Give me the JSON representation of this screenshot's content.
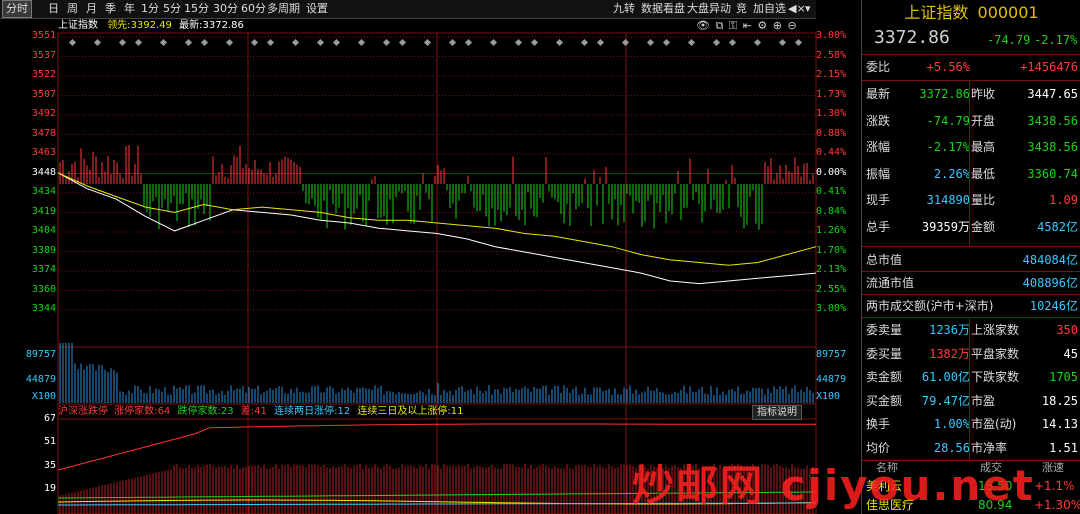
{
  "toolbar": {
    "left_items": [
      "分时",
      "日",
      "周",
      "月",
      "季",
      "年",
      "1分",
      "5分",
      "15分",
      "30分",
      "60分",
      "多周期",
      "设置"
    ],
    "right_items": [
      "九转",
      "数据看盘",
      "大盘异动",
      "竞",
      "加自选"
    ],
    "icons": [
      "sound-icon",
      "chevron-down-icon"
    ]
  },
  "chart_header": {
    "title": "上证指数",
    "leader_label": "领先:",
    "leader_value": "3392.49",
    "latest_label": "最新:",
    "latest_value": "3372.86",
    "icons": [
      "eye-icon",
      "copy-icon",
      "key-icon",
      "collapse-icon",
      "settings-icon",
      "zoom-in-icon",
      "zoom-out-icon"
    ]
  },
  "price_axis": {
    "left": [
      "3551",
      "3537",
      "3522",
      "3507",
      "3492",
      "3478",
      "3463",
      "3448",
      "3434",
      "3419",
      "3404",
      "3389",
      "3374",
      "3360",
      "3344"
    ],
    "right": [
      "3.00%",
      "2.58%",
      "2.15%",
      "1.73%",
      "1.30%",
      "0.88%",
      "0.44%",
      "0.00%",
      "0.41%",
      "0.84%",
      "1.26%",
      "1.70%",
      "2.13%",
      "2.55%",
      "3.00%"
    ]
  },
  "volume_axis": {
    "left": [
      "89757",
      "44879",
      "X100"
    ],
    "right": [
      "89757",
      "44879",
      "X100"
    ]
  },
  "indicator_bar": {
    "title": "沪深涨跌停",
    "limit_up_label": "涨停家数:",
    "limit_up_value": "64",
    "limit_down_label": "跌停家数:",
    "limit_down_value": "23",
    "diff_label": "差:",
    "diff_value": "41",
    "two_day_label": "连续两日涨停:",
    "two_day_value": "12",
    "three_day_label": "连续三日及以上涨停:",
    "three_day_value": "11",
    "explain_button": "指标说明"
  },
  "indicator_axis": [
    "67",
    "51",
    "35",
    "19"
  ],
  "chart_data": {
    "type": "line",
    "series": [
      {
        "values": [
          3448,
          3436,
          3428,
          3415,
          3404,
          3412,
          3420,
          3418,
          3416,
          3412,
          3410,
          3406,
          3404,
          3402,
          3398,
          3392,
          3388,
          3384,
          3380,
          3376,
          3372,
          3366,
          3364,
          3366,
          3368,
          3370,
          3372
        ]
      },
      {
        "values": [
          3448,
          3438,
          3430,
          3422,
          3418,
          3424,
          3420,
          3422,
          3420,
          3418,
          3414,
          3412,
          3412,
          3410,
          3408,
          3406,
          3402,
          3400,
          3396,
          3392,
          3386,
          3382,
          3380,
          3378,
          3380,
          3386,
          3392
        ]
      }
    ],
    "ylim": [
      3344,
      3551
    ]
  },
  "panel": {
    "title": "上证指数",
    "code": "000001",
    "price": "3372.86",
    "change": "-74.79",
    "change_pct": "-2.17%",
    "commission_ratio_label": "委比",
    "commission_ratio": "+5.56%",
    "commission_diff": "+1456476",
    "stats": [
      {
        "l1": "最新",
        "v1": "3372.86",
        "c1": "green",
        "l2": "昨收",
        "v2": "3447.65",
        "c2": "white"
      },
      {
        "l1": "涨跌",
        "v1": "-74.79",
        "c1": "green",
        "l2": "开盘",
        "v2": "3438.56",
        "c2": "green"
      },
      {
        "l1": "涨幅",
        "v1": "-2.17%",
        "c1": "green",
        "l2": "最高",
        "v2": "3438.56",
        "c2": "green"
      },
      {
        "l1": "振幅",
        "v1": "2.26%",
        "c1": "cyan",
        "l2": "最低",
        "v2": "3360.74",
        "c2": "green"
      },
      {
        "l1": "现手",
        "v1": "314890",
        "c1": "cyan",
        "l2": "量比",
        "v2": "1.09",
        "c2": "red"
      },
      {
        "l1": "总手",
        "v1": "39359万",
        "c1": "white",
        "l2": "金额",
        "v2": "4582亿",
        "c2": "cyan"
      }
    ],
    "market": [
      {
        "l": "总市值",
        "v": "484084亿",
        "c": "cyan"
      },
      {
        "l": "流通市值",
        "v": "408896亿",
        "c": "cyan"
      },
      {
        "l": "两市成交额(沪市+深市)",
        "v": "10246亿",
        "c": "cyan"
      }
    ],
    "stats2": [
      {
        "l1": "委卖量",
        "v1": "1236万",
        "c1": "cyan",
        "l2": "上涨家数",
        "v2": "350",
        "c2": "red"
      },
      {
        "l1": "委买量",
        "v1": "1382万",
        "c1": "red",
        "l2": "平盘家数",
        "v2": "45",
        "c2": "white"
      },
      {
        "l1": "卖金额",
        "v1": "61.00亿",
        "c1": "cyan",
        "l2": "下跌家数",
        "v2": "1705",
        "c2": "green"
      },
      {
        "l1": "买金额",
        "v1": "79.47亿",
        "c1": "cyan",
        "l2": "市盈",
        "v2": "18.25",
        "c2": "white"
      },
      {
        "l1": "换手",
        "v1": "1.00%",
        "c1": "cyan",
        "l2": "市盈(动)",
        "v2": "14.13",
        "c2": "white"
      },
      {
        "l1": "均价",
        "v1": "28.56",
        "c1": "cyan",
        "l2": "市净率",
        "v2": "1.51",
        "c2": "white"
      }
    ],
    "list_headers": [
      "名称",
      "成交",
      "涨速"
    ],
    "list_rows": [
      {
        "name": "美利云",
        "price": "15.50",
        "speed": "+1.1%"
      },
      {
        "name": "佳思医疗",
        "price": "80.94",
        "speed": "+1.30%"
      }
    ]
  },
  "watermark": "炒邮网 cjiyou.net",
  "colors": {
    "up": "#ff3b3b",
    "down": "#19d219",
    "grid": "#7a1010",
    "bg": "#000000"
  }
}
